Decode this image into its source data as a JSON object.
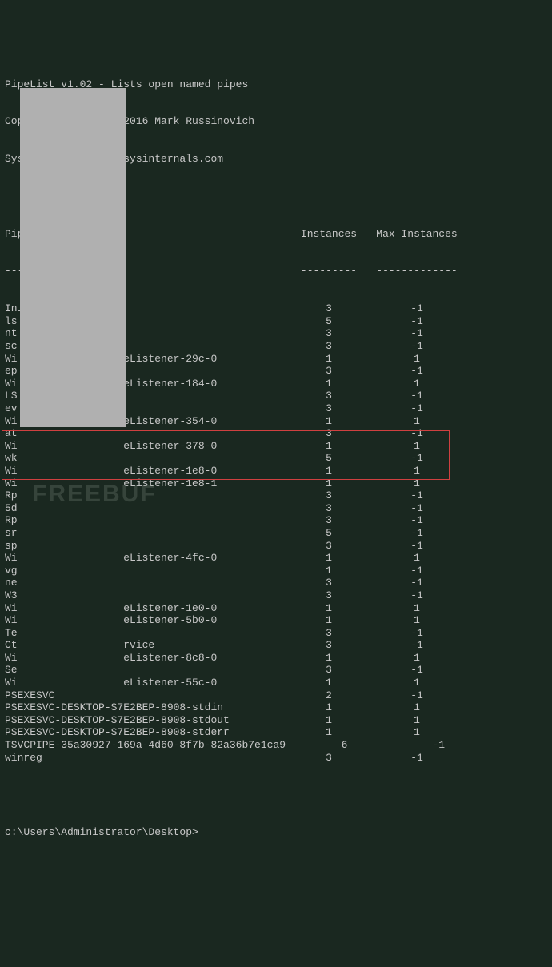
{
  "header": {
    "line1": "PipeList v1.02 - Lists open named pipes",
    "line2": "Copyright (C) 2005-2016 Mark Russinovich",
    "line3": "Sysinternals - www.sysinternals.com"
  },
  "columns": {
    "name": "Pipe Name",
    "instances": "Instances",
    "max": "Max Instances"
  },
  "separators": {
    "name": "---------",
    "instances": "---------",
    "max": "-------------"
  },
  "rows": [
    {
      "name": "InitShutdown",
      "inst": "3",
      "max": "-1"
    },
    {
      "name": "ls",
      "inst": "5",
      "max": "-1"
    },
    {
      "name": "nt",
      "inst": "3",
      "max": "-1"
    },
    {
      "name": "sc",
      "inst": "3",
      "max": "-1"
    },
    {
      "name": "Wi                 eListener-29c-0",
      "inst": "1",
      "max": "1"
    },
    {
      "name": "ep",
      "inst": "3",
      "max": "-1"
    },
    {
      "name": "Wi                 eListener-184-0",
      "inst": "1",
      "max": "1"
    },
    {
      "name": "LS",
      "inst": "3",
      "max": "-1"
    },
    {
      "name": "ev",
      "inst": "3",
      "max": "-1"
    },
    {
      "name": "Wi                 eListener-354-0",
      "inst": "1",
      "max": "1"
    },
    {
      "name": "at",
      "inst": "3",
      "max": "-1"
    },
    {
      "name": "Wi                 eListener-378-0",
      "inst": "1",
      "max": "1"
    },
    {
      "name": "wk",
      "inst": "5",
      "max": "-1"
    },
    {
      "name": "Wi                 eListener-1e8-0",
      "inst": "1",
      "max": "1"
    },
    {
      "name": "Wi                 eListener-1e8-1",
      "inst": "1",
      "max": "1"
    },
    {
      "name": "Rp",
      "inst": "3",
      "max": "-1"
    },
    {
      "name": "5d",
      "inst": "3",
      "max": "-1"
    },
    {
      "name": "Rp",
      "inst": "3",
      "max": "-1"
    },
    {
      "name": "sr",
      "inst": "5",
      "max": "-1"
    },
    {
      "name": "sp",
      "inst": "3",
      "max": "-1"
    },
    {
      "name": "Wi                 eListener-4fc-0",
      "inst": "1",
      "max": "1"
    },
    {
      "name": "vg",
      "inst": "1",
      "max": "-1"
    },
    {
      "name": "ne",
      "inst": "3",
      "max": "-1"
    },
    {
      "name": "W3",
      "inst": "3",
      "max": "-1"
    },
    {
      "name": "Wi                 eListener-1e0-0",
      "inst": "1",
      "max": "1"
    },
    {
      "name": "Wi                 eListener-5b0-0",
      "inst": "1",
      "max": "1"
    },
    {
      "name": "Te",
      "inst": "3",
      "max": "-1"
    },
    {
      "name": "Ct                 rvice",
      "inst": "3",
      "max": "-1"
    },
    {
      "name": "Wi                 eListener-8c8-0",
      "inst": "1",
      "max": "1"
    },
    {
      "name": "Se",
      "inst": "3",
      "max": "-1"
    },
    {
      "name": "Wi                 eListener-55c-0",
      "inst": "1",
      "max": "1"
    },
    {
      "name": "PSEXESVC",
      "inst": "2",
      "max": "-1"
    },
    {
      "name": "PSEXESVC-DESKTOP-S7E2BEP-8908-stdin",
      "inst": "1",
      "max": "1"
    },
    {
      "name": "PSEXESVC-DESKTOP-S7E2BEP-8908-stdout",
      "inst": "1",
      "max": "1"
    },
    {
      "name": "PSEXESVC-DESKTOP-S7E2BEP-8908-stderr",
      "inst": "1",
      "max": "1"
    },
    {
      "name": "TSVCPIPE-35a30927-169a-4d60-8f7b-82a36b7e1ca9",
      "inst": "     6",
      "max": "       -1"
    },
    {
      "name": "winreg",
      "inst": "3",
      "max": "-1"
    }
  ],
  "prompt": "c:\\Users\\Administrator\\Desktop>",
  "watermark": "FREEBUF"
}
